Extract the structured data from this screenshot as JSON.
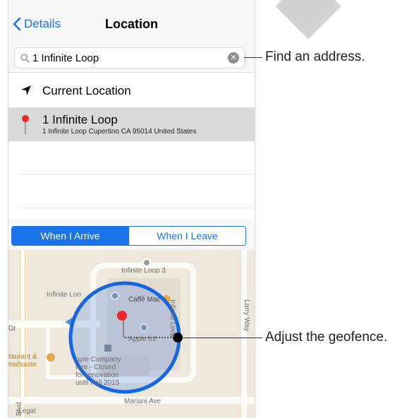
{
  "nav": {
    "back_label": "Details",
    "title": "Location"
  },
  "search": {
    "value": "1 Infinite Loop"
  },
  "list": {
    "current_location": "Current Location",
    "result_title": "1 Infinite Loop",
    "result_subtitle": "1 Infinite Loop Cupertino CA 95014 United States"
  },
  "segment": {
    "arrive": "When I Arrive",
    "leave": "When I Leave",
    "selected": "When I Arrive"
  },
  "map": {
    "labels": {
      "infinite_loop_3": "Infinite Loop 3",
      "infinite_loop_left": "Infinite Loo",
      "caffe": "Caffè Mac",
      "infinite_loop_vertical": "Infinite Loop",
      "larry_way": "Larry Way",
      "dr": "Dr",
      "restaurant": "taurant &\newhouse",
      "apple_inf": "Apple Inf",
      "apple_company": "pple Company\ntore - Closed\nfor renovation\nuntil Fall 2015",
      "mariani": "Mariani Ave",
      "blvd": "Blvd",
      "legal": "Legal"
    }
  },
  "callouts": {
    "find": "Find an address.",
    "adjust": "Adjust the geofence."
  },
  "colors": {
    "accent": "#1a73e8",
    "geofence": "#1466e6",
    "pin": "#e8262b"
  }
}
